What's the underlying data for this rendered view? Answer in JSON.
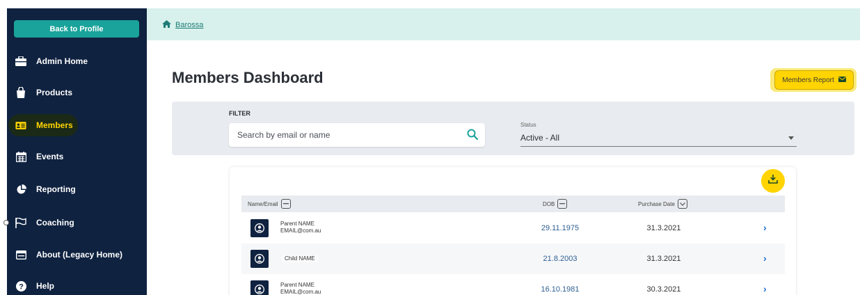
{
  "sidebar": {
    "back_label": "Back to Profile",
    "items": [
      {
        "label": "Admin Home",
        "icon": "briefcase-icon"
      },
      {
        "label": "Products",
        "icon": "shopping-bag-icon"
      },
      {
        "label": "Members",
        "icon": "id-card-icon",
        "active": true
      },
      {
        "label": "Events",
        "icon": "calendar-icon"
      },
      {
        "label": "Reporting",
        "icon": "pie-chart-icon"
      },
      {
        "label": "Coaching",
        "icon": "flag-icon"
      },
      {
        "label": "About (Legacy Home)",
        "icon": "window-icon"
      },
      {
        "label": "Help",
        "icon": "question-circle-icon"
      }
    ]
  },
  "breadcrumb": {
    "home_label": "Barossa"
  },
  "page": {
    "title": "Members Dashboard",
    "report_label": "Members Report"
  },
  "filter": {
    "label": "FILTER",
    "search_placeholder": "Search by email or name",
    "status_label": "Status",
    "status_value": "Active - All"
  },
  "table": {
    "headers": {
      "name": "Name/Email",
      "dob": "DOB",
      "purchase": "Purchase Date"
    },
    "rows": [
      {
        "name": "Parent NAME",
        "email": "EMAIL@com.au",
        "dob": "29.11.1975",
        "purchase": "31.3.2021"
      },
      {
        "name": "Child NAME",
        "email": "",
        "dob": "21.8.2003",
        "purchase": "31.3.2021"
      },
      {
        "name": "Parent NAME",
        "email": "EMAIL@com.au",
        "dob": "16.10.1981",
        "purchase": "30.3.2021"
      }
    ]
  },
  "colors": {
    "sidebar": "#0f2240",
    "accent_teal": "#1aa39a",
    "accent_yellow": "#ffd400",
    "topbar": "#d8f1ec"
  }
}
